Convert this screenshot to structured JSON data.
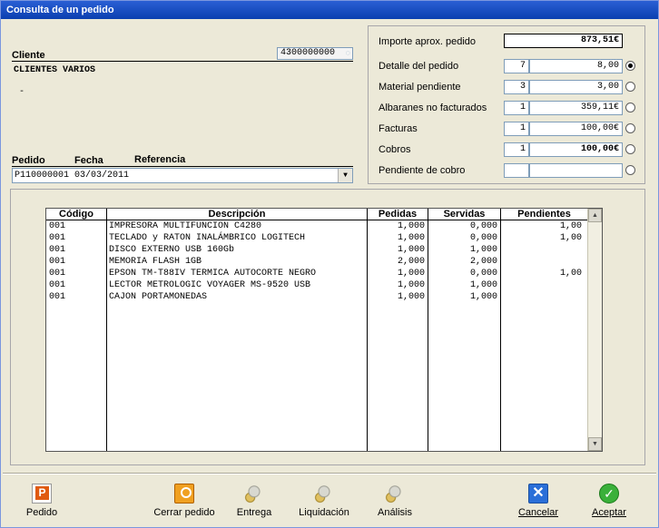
{
  "window": {
    "title": "Consulta de un pedido"
  },
  "cliente": {
    "label": "Cliente",
    "code": "4300000000",
    "name": "CLIENTES VARIOS",
    "extra": "-"
  },
  "pedido_header": {
    "pedido_label": "Pedido",
    "fecha_label": "Fecha",
    "referencia_label": "Referencia",
    "selected": "P110000001 03/03/2011"
  },
  "summary": {
    "importe_label": "Importe aprox. pedido",
    "importe_value": "873,51€",
    "rows": [
      {
        "label": "Detalle del pedido",
        "count": "7",
        "amount": "8,00",
        "selected": true
      },
      {
        "label": "Material pendiente",
        "count": "3",
        "amount": "3,00",
        "selected": false
      },
      {
        "label": "Albaranes no facturados",
        "count": "1",
        "amount": "359,11€",
        "selected": false
      },
      {
        "label": "Facturas",
        "count": "1",
        "amount": "100,00€",
        "selected": false
      },
      {
        "label": "Cobros",
        "count": "1",
        "amount": "100,00€",
        "selected": false
      },
      {
        "label": "Pendiente de cobro",
        "count": "",
        "amount": "",
        "selected": false
      }
    ]
  },
  "grid": {
    "columns": [
      "Código",
      "Descripción",
      "Pedidas",
      "Servidas",
      "Pendientes"
    ],
    "rows": [
      [
        "001",
        "IMPRESORA MULTIFUNCION C4280",
        "1,000",
        "0,000",
        "1,00"
      ],
      [
        "001",
        "TECLADO y RATON INALÁMBRICO LOGITECH",
        "1,000",
        "0,000",
        "1,00"
      ],
      [
        "001",
        "DISCO EXTERNO USB 160Gb",
        "1,000",
        "1,000",
        ""
      ],
      [
        "001",
        "MEMORIA FLASH 1GB",
        "2,000",
        "2,000",
        ""
      ],
      [
        "001",
        "EPSON TM-T88IV TERMICA AUTOCORTE NEGRO",
        "1,000",
        "0,000",
        "1,00"
      ],
      [
        "001",
        "LECTOR METROLOGIC VOYAGER MS-9520 USB",
        "1,000",
        "1,000",
        ""
      ],
      [
        "001",
        "CAJON PORTAMONEDAS",
        "1,000",
        "1,000",
        ""
      ]
    ]
  },
  "toolbar": {
    "pedido": "Pedido",
    "cerrar": "Cerrar pedido",
    "entrega": "Entrega",
    "liquidacion": "Liquidación",
    "analisis": "Análisis",
    "cancelar": "Cancelar",
    "aceptar": "Aceptar"
  }
}
